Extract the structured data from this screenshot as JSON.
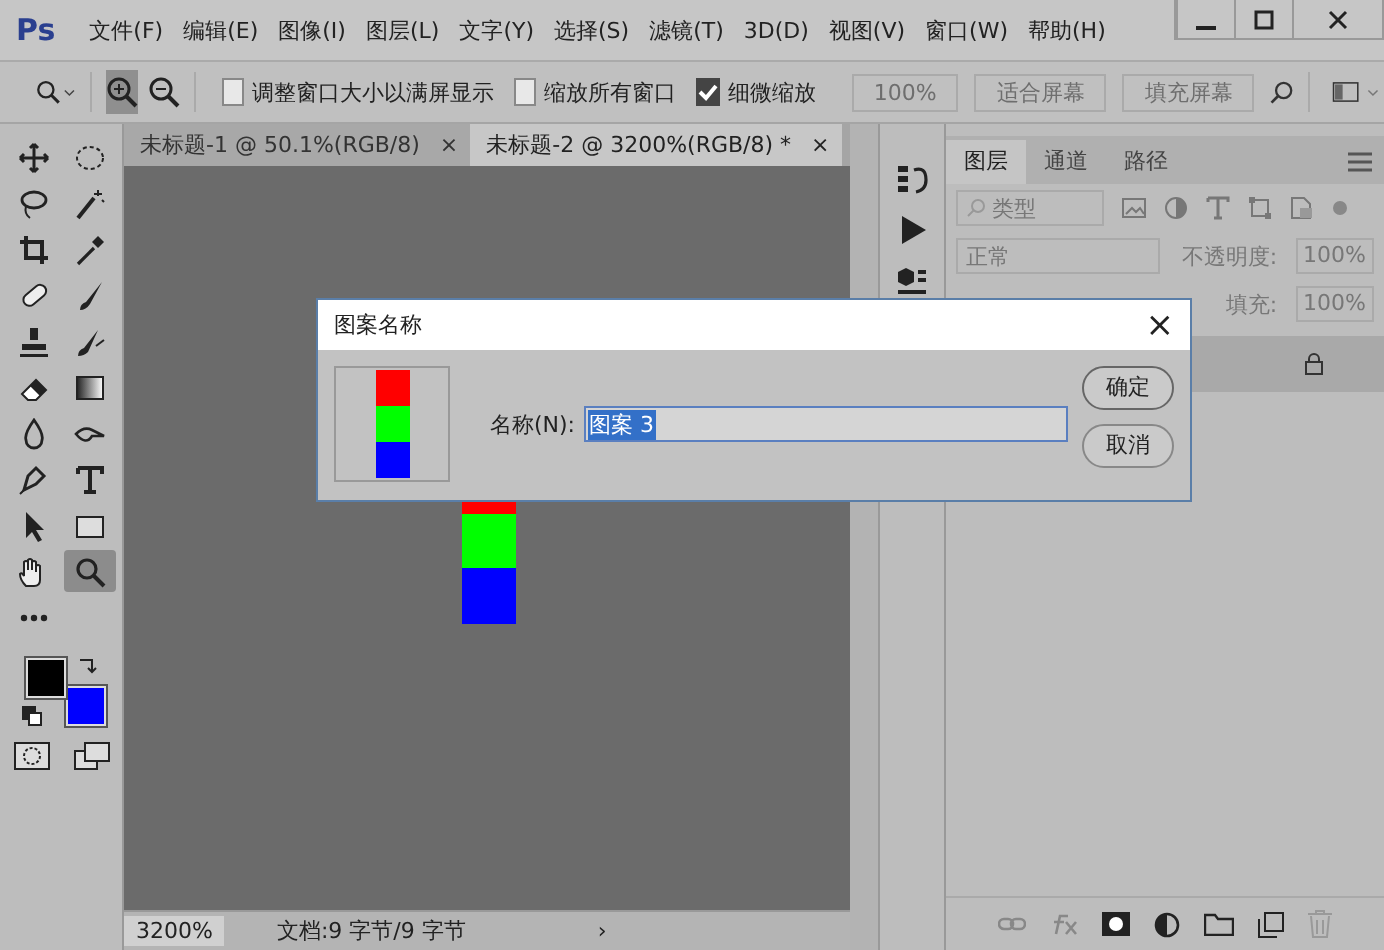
{
  "app": {
    "logo": "Ps"
  },
  "menu": [
    "文件(F)",
    "编辑(E)",
    "图像(I)",
    "图层(L)",
    "文字(Y)",
    "选择(S)",
    "滤镜(T)",
    "3D(D)",
    "视图(V)",
    "窗口(W)",
    "帮助(H)"
  ],
  "options_bar": {
    "zoom_in_selected": true,
    "checkboxes": [
      {
        "label": "调整窗口大小以满屏显示",
        "checked": false
      },
      {
        "label": "缩放所有窗口",
        "checked": false
      },
      {
        "label": "细微缩放",
        "checked": true
      }
    ],
    "buttons": [
      {
        "label": "100%",
        "disabled": true
      },
      {
        "label": "适合屏幕",
        "disabled": true
      },
      {
        "label": "填充屏幕",
        "disabled": true
      }
    ]
  },
  "tools": [
    {
      "kind": "move",
      "selected": false
    },
    {
      "kind": "marquee",
      "selected": false
    },
    {
      "kind": "lasso",
      "selected": false
    },
    {
      "kind": "wand",
      "selected": false
    },
    {
      "kind": "crop",
      "selected": false
    },
    {
      "kind": "eyedropper",
      "selected": false
    },
    {
      "kind": "bandage",
      "selected": false
    },
    {
      "kind": "brush",
      "selected": false
    },
    {
      "kind": "stamp",
      "selected": false
    },
    {
      "kind": "history",
      "selected": false
    },
    {
      "kind": "eraser",
      "selected": false
    },
    {
      "kind": "gradient",
      "selected": false
    },
    {
      "kind": "drop",
      "selected": false
    },
    {
      "kind": "dodge",
      "selected": false
    },
    {
      "kind": "pen",
      "selected": false
    },
    {
      "kind": "type",
      "selected": false
    },
    {
      "kind": "arrow",
      "selected": false
    },
    {
      "kind": "rect",
      "selected": false
    },
    {
      "kind": "hand",
      "selected": false
    },
    {
      "kind": "zoom",
      "selected": true
    }
  ],
  "swatches": {
    "foreground": {
      "color": "#000000"
    },
    "background": {
      "color": "#0000ff"
    }
  },
  "document_tabs": [
    {
      "title": "未标题-1 @ 50.1%(RGB/8)",
      "close": "×",
      "selected": false
    },
    {
      "title": "未标题-2 @ 3200%(RGB/8) *",
      "close": "×",
      "selected": true
    }
  ],
  "status_bar": {
    "zoom": "3200%",
    "doc_info": "文档:9 字节/9 字节",
    "arrow": "›"
  },
  "dialog": {
    "title": "图案名称",
    "close": "×",
    "name_label": "名称(N):",
    "name_value": "图案 3",
    "buttons": [
      "确定",
      "取消"
    ]
  },
  "layers_panel": {
    "tabs": [
      {
        "label": "图层",
        "selected": true
      },
      {
        "label": "通道",
        "selected": false
      },
      {
        "label": "路径",
        "selected": false
      }
    ],
    "filter": "类型",
    "blend_mode": "正常",
    "opacity_label": "不透明度:",
    "opacity": "100%",
    "fill_label": "填充:",
    "fill": "100%",
    "layer_locked": true
  }
}
